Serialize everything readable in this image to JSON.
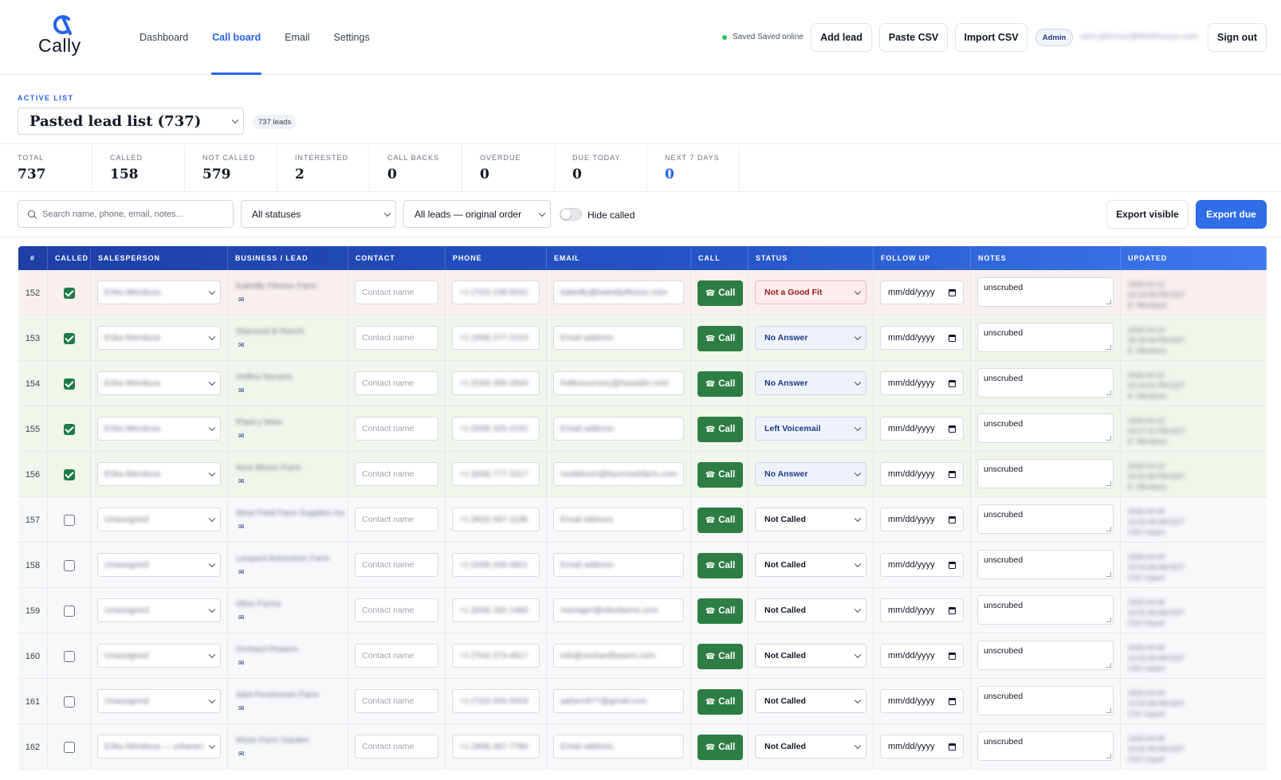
{
  "brand": {
    "name": "Cally"
  },
  "nav": [
    {
      "label": "Dashboard",
      "active": false
    },
    {
      "label": "Call board",
      "active": true
    },
    {
      "label": "Email",
      "active": false
    },
    {
      "label": "Settings",
      "active": false
    }
  ],
  "topbar": {
    "saved_status": "Saved Saved online",
    "add_lead": "Add lead",
    "paste_csv": "Paste CSV",
    "import_csv": "Import CSV",
    "role_badge": "Admin",
    "user_email": "sam.johnson@fieldhouse.com",
    "sign_out": "Sign out"
  },
  "active_list": {
    "label": "ACTIVE LIST",
    "selected": "Pasted lead list (737)",
    "count_badge": "737 leads"
  },
  "stats": [
    {
      "label": "TOTAL",
      "value": "737",
      "highlight": false
    },
    {
      "label": "CALLED",
      "value": "158",
      "highlight": false
    },
    {
      "label": "NOT CALLED",
      "value": "579",
      "highlight": false
    },
    {
      "label": "INTERESTED",
      "value": "2",
      "highlight": false
    },
    {
      "label": "CALL BACKS",
      "value": "0",
      "highlight": false
    },
    {
      "label": "OVERDUE",
      "value": "0",
      "highlight": false
    },
    {
      "label": "DUE TODAY",
      "value": "0",
      "highlight": false
    },
    {
      "label": "NEXT 7 DAYS",
      "value": "0",
      "highlight": true
    }
  ],
  "filters": {
    "search_placeholder": "Search name, phone, email, notes...",
    "status_filter": "All statuses",
    "order_filter": "All leads — original order",
    "hide_called": "Hide called",
    "export_visible": "Export visible",
    "export_due": "Export due"
  },
  "table": {
    "columns": [
      "#",
      "CALLED",
      "SALESPERSON",
      "BUSINESS / LEAD",
      "CONTACT",
      "PHONE",
      "EMAIL",
      "CALL",
      "STATUS",
      "FOLLOW UP",
      "NOTES",
      "UPDATED"
    ],
    "contact_placeholder": "Contact name",
    "email_placeholder": "Email address",
    "call_label": "Call",
    "date_placeholder": "mm/dd/yyyy",
    "mail_glyph": "✉",
    "rows": [
      {
        "num": "152",
        "called": true,
        "tone": "red",
        "salesperson": "Erika Mendoza",
        "business": "Kaleidly Fitness Farm",
        "phone": "+1 (702) 238-5531",
        "email": "kaleidly@kaleidlyfitness.com",
        "status": "Not a Good Fit",
        "status_tone": "bad",
        "notes": "unscrubed",
        "updated": [
          "2026-04-12",
          "02:14:08 PM EDT",
          "E. Mendoza"
        ]
      },
      {
        "num": "153",
        "called": true,
        "tone": "green",
        "salesperson": "Erika Mendoza",
        "business": "Diamond B Ranch",
        "phone": "+1 (308) 277-2153",
        "email": "",
        "status": "No Answer",
        "status_tone": "info",
        "notes": "unscrubed",
        "updated": [
          "2026-04-12",
          "02:19:44 PM EDT",
          "E. Mendoza"
        ]
      },
      {
        "num": "154",
        "called": true,
        "tone": "green",
        "salesperson": "Erika Mendoza",
        "business": "Hollins Nursery",
        "phone": "+1 (530) 356-2940",
        "email": "hollinsnursery@hawaiiin.com",
        "status": "No Answer",
        "status_tone": "info",
        "notes": "unscrubed",
        "updated": [
          "2026-04-12",
          "02:23:51 PM EDT",
          "E. Mendoza"
        ]
      },
      {
        "num": "155",
        "called": true,
        "tone": "green",
        "salesperson": "Erika Mendoza",
        "business": "Plant y Wise",
        "phone": "+1 (559) 325-2231",
        "email": "",
        "status": "Left Voicemail",
        "status_tone": "info",
        "notes": "unscrubed",
        "updated": [
          "2026-04-12",
          "02:27:12 PM EDT",
          "E. Mendoza"
        ]
      },
      {
        "num": "156",
        "called": true,
        "tone": "green",
        "salesperson": "Erika Mendoza",
        "business": "Next Bloom Farm",
        "phone": "+1 (509) 777-2217",
        "email": "nextbloom@fourmeshfarm.com",
        "status": "No Answer",
        "status_tone": "info",
        "notes": "unscrubed",
        "updated": [
          "2026-04-12",
          "02:31:06 PM EDT",
          "E. Mendoza"
        ]
      },
      {
        "num": "157",
        "called": false,
        "tone": "plain",
        "salesperson": "Unassigned",
        "business": "West Field Farm Supplies Inc",
        "phone": "+1 (802) 597-1198",
        "email": "",
        "status": "Not Called",
        "status_tone": "",
        "notes": "unscrubed",
        "updated": [
          "2026-04-09",
          "10:02:48 AM EDT",
          "CSV import"
        ]
      },
      {
        "num": "158",
        "called": false,
        "tone": "plain",
        "salesperson": "Unassigned",
        "business": "Leopard Arboretum Farm",
        "phone": "+1 (209) 436-5821",
        "email": "",
        "status": "Not Called",
        "status_tone": "",
        "notes": "unscrubed",
        "updated": [
          "2026-04-09",
          "10:02:48 AM EDT",
          "CSV import"
        ]
      },
      {
        "num": "159",
        "called": false,
        "tone": "plain",
        "salesperson": "Unassigned",
        "business": "Olivo Farms",
        "phone": "+1 (559) 292-1465",
        "email": "manager@olivofarms.com",
        "status": "Not Called",
        "status_tone": "",
        "notes": "unscrubed",
        "updated": [
          "2026-04-09",
          "10:02:48 AM EDT",
          "CSV import"
        ]
      },
      {
        "num": "160",
        "called": false,
        "tone": "plain",
        "salesperson": "Unassigned",
        "business": "Orchard Flowers",
        "phone": "+1 (704) 573-4817",
        "email": "info@orchardflowers.com",
        "status": "Not Called",
        "status_tone": "",
        "notes": "unscrubed",
        "updated": [
          "2026-04-09",
          "10:02:48 AM EDT",
          "CSV import"
        ]
      },
      {
        "num": "161",
        "called": false,
        "tone": "plain",
        "salesperson": "Unassigned",
        "business": "A&A Persimmon Farm",
        "phone": "+1 (720) 556-5504",
        "email": "aafarm877@gmail.com",
        "status": "Not Called",
        "status_tone": "",
        "notes": "unscrubed",
        "updated": [
          "2026-04-09",
          "10:02:48 AM EDT",
          "CSV import"
        ]
      },
      {
        "num": "162",
        "called": false,
        "tone": "plain",
        "salesperson": "Erika Mendoza — urbanes",
        "business": "Moon Farm Garden",
        "phone": "+1 (308) 457-7780",
        "email": "",
        "status": "Not Called",
        "status_tone": "",
        "notes": "unscrubed",
        "updated": [
          "2026-04-09",
          "10:02:48 AM EDT",
          "CSV import"
        ]
      }
    ]
  },
  "colors": {
    "accent": "#2563eb",
    "call_button": "#2e7d45",
    "row_red": "#f8f0ef",
    "row_green": "#f1f6ec",
    "row_plain": "#f7f8fa"
  }
}
